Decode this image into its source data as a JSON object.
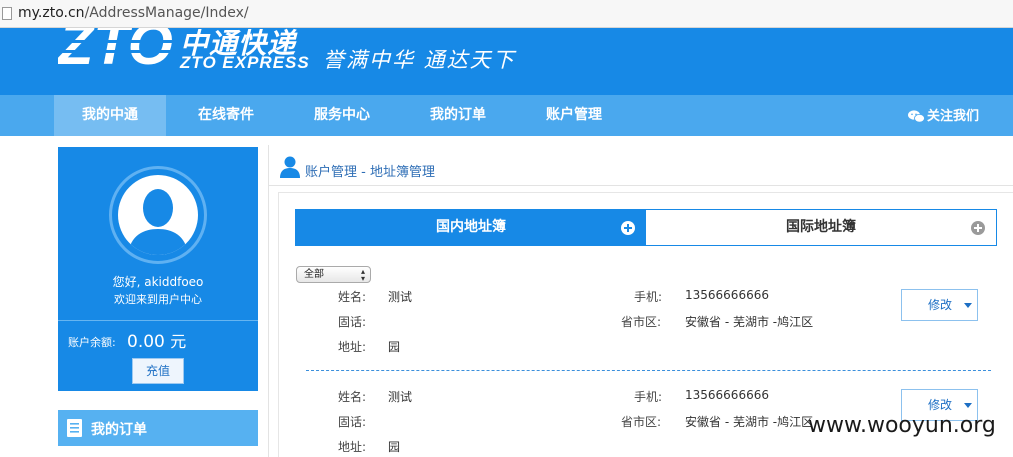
{
  "browser": {
    "url_domain": "my.zto.cn",
    "url_path": "/AddressManage/Index/"
  },
  "header": {
    "logo_text": "ZTO",
    "logo_cn": "中通快递",
    "logo_en": "ZTO EXPRESS",
    "slogan": "誉满中华 通达天下",
    "brand_color": "#1789e6"
  },
  "nav": {
    "items": [
      {
        "label": "我的中通",
        "active": true
      },
      {
        "label": "在线寄件",
        "active": false
      },
      {
        "label": "服务中心",
        "active": false
      },
      {
        "label": "我的订单",
        "active": false
      },
      {
        "label": "账户管理",
        "active": false
      }
    ],
    "follow_label": "关注我们",
    "follow_icon": "wechat-icon"
  },
  "sidebar": {
    "greeting": "您好, akiddfoeo",
    "welcome": "欢迎来到用户中心",
    "balance_label": "账户余额:",
    "balance_amount": "0.00",
    "balance_unit": "元",
    "recharge_label": "充值",
    "orders_label": "我的订单"
  },
  "main": {
    "breadcrumb": "账户管理 - 地址簿管理",
    "tabs": [
      {
        "label": "国内地址簿",
        "active": true
      },
      {
        "label": "国际地址簿",
        "active": false
      }
    ],
    "filter": {
      "selected": "全部"
    },
    "field_labels": {
      "name": "姓名:",
      "phone": "固话:",
      "address": "地址:",
      "mobile": "手机:",
      "region": "省市区:"
    },
    "addresses": [
      {
        "name": "测试",
        "phone": "",
        "address": "园",
        "mobile": "13566666666",
        "region": "安徽省 - 芜湖市 -鸠江区",
        "edit_label": "修改"
      },
      {
        "name": "测试",
        "phone": "",
        "address": "园",
        "mobile": "13566666666",
        "region": "安徽省 - 芜湖市 -鸠江区",
        "edit_label": "修改"
      }
    ]
  },
  "watermark": "www.wooyun.org"
}
